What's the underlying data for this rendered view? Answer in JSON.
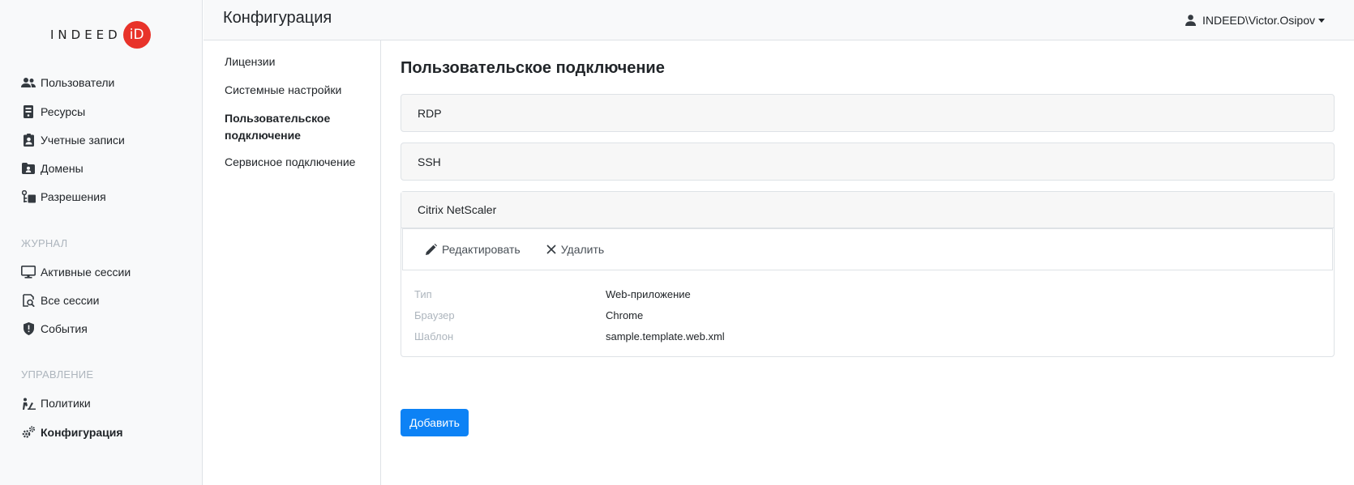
{
  "logo": {
    "text": "INDEED",
    "badge": "iD"
  },
  "sidebar": {
    "main_items": [
      {
        "label": "Пользователи",
        "icon": "users-icon"
      },
      {
        "label": "Ресурсы",
        "icon": "server-icon"
      },
      {
        "label": "Учетные записи",
        "icon": "account-badge-icon"
      },
      {
        "label": "Домены",
        "icon": "domain-folder-icon"
      },
      {
        "label": "Разрешения",
        "icon": "permissions-icon"
      }
    ],
    "section_journal": "ЖУРНАЛ",
    "journal_items": [
      {
        "label": "Активные сессии",
        "icon": "monitor-icon"
      },
      {
        "label": "Все сессии",
        "icon": "session-search-icon"
      },
      {
        "label": "События",
        "icon": "event-shield-icon"
      }
    ],
    "section_management": "УПРАВЛЕНИЕ",
    "management_items": [
      {
        "label": "Политики",
        "icon": "policy-icon"
      },
      {
        "label": "Конфигурация",
        "icon": "gears-icon"
      }
    ]
  },
  "header": {
    "title": "Конфигурация",
    "user": "INDEED\\Victor.Osipov"
  },
  "subnav": {
    "items": [
      {
        "label": "Лицензии"
      },
      {
        "label": "Системные настройки"
      },
      {
        "label": "Пользовательское подключение"
      },
      {
        "label": "Сервисное подключение"
      }
    ]
  },
  "main": {
    "title": "Пользовательское подключение",
    "panels": [
      {
        "label": "RDP"
      },
      {
        "label": "SSH"
      },
      {
        "label": "Citrix NetScaler"
      }
    ],
    "toolbar": {
      "edit": "Редактировать",
      "delete": "Удалить"
    },
    "properties": [
      {
        "label": "Тип",
        "value": "Web-приложение"
      },
      {
        "label": "Браузер",
        "value": "Chrome"
      },
      {
        "label": "Шаблон",
        "value": "sample.template.web.xml"
      }
    ],
    "add_button": "Добавить"
  },
  "colors": {
    "accent": "#0d82f5",
    "logo_badge": "#e8332a",
    "muted": "#adb5bd"
  }
}
